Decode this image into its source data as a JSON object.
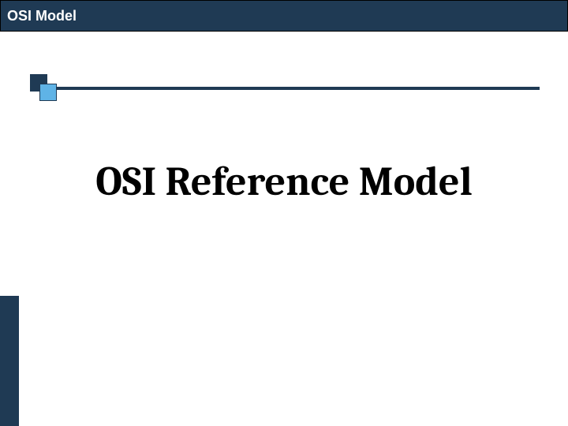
{
  "header": {
    "title": "OSI Model"
  },
  "main": {
    "title": "OSI Reference Model"
  },
  "colors": {
    "brand_dark": "#1f3a54",
    "accent_light": "#5fb3e6"
  }
}
